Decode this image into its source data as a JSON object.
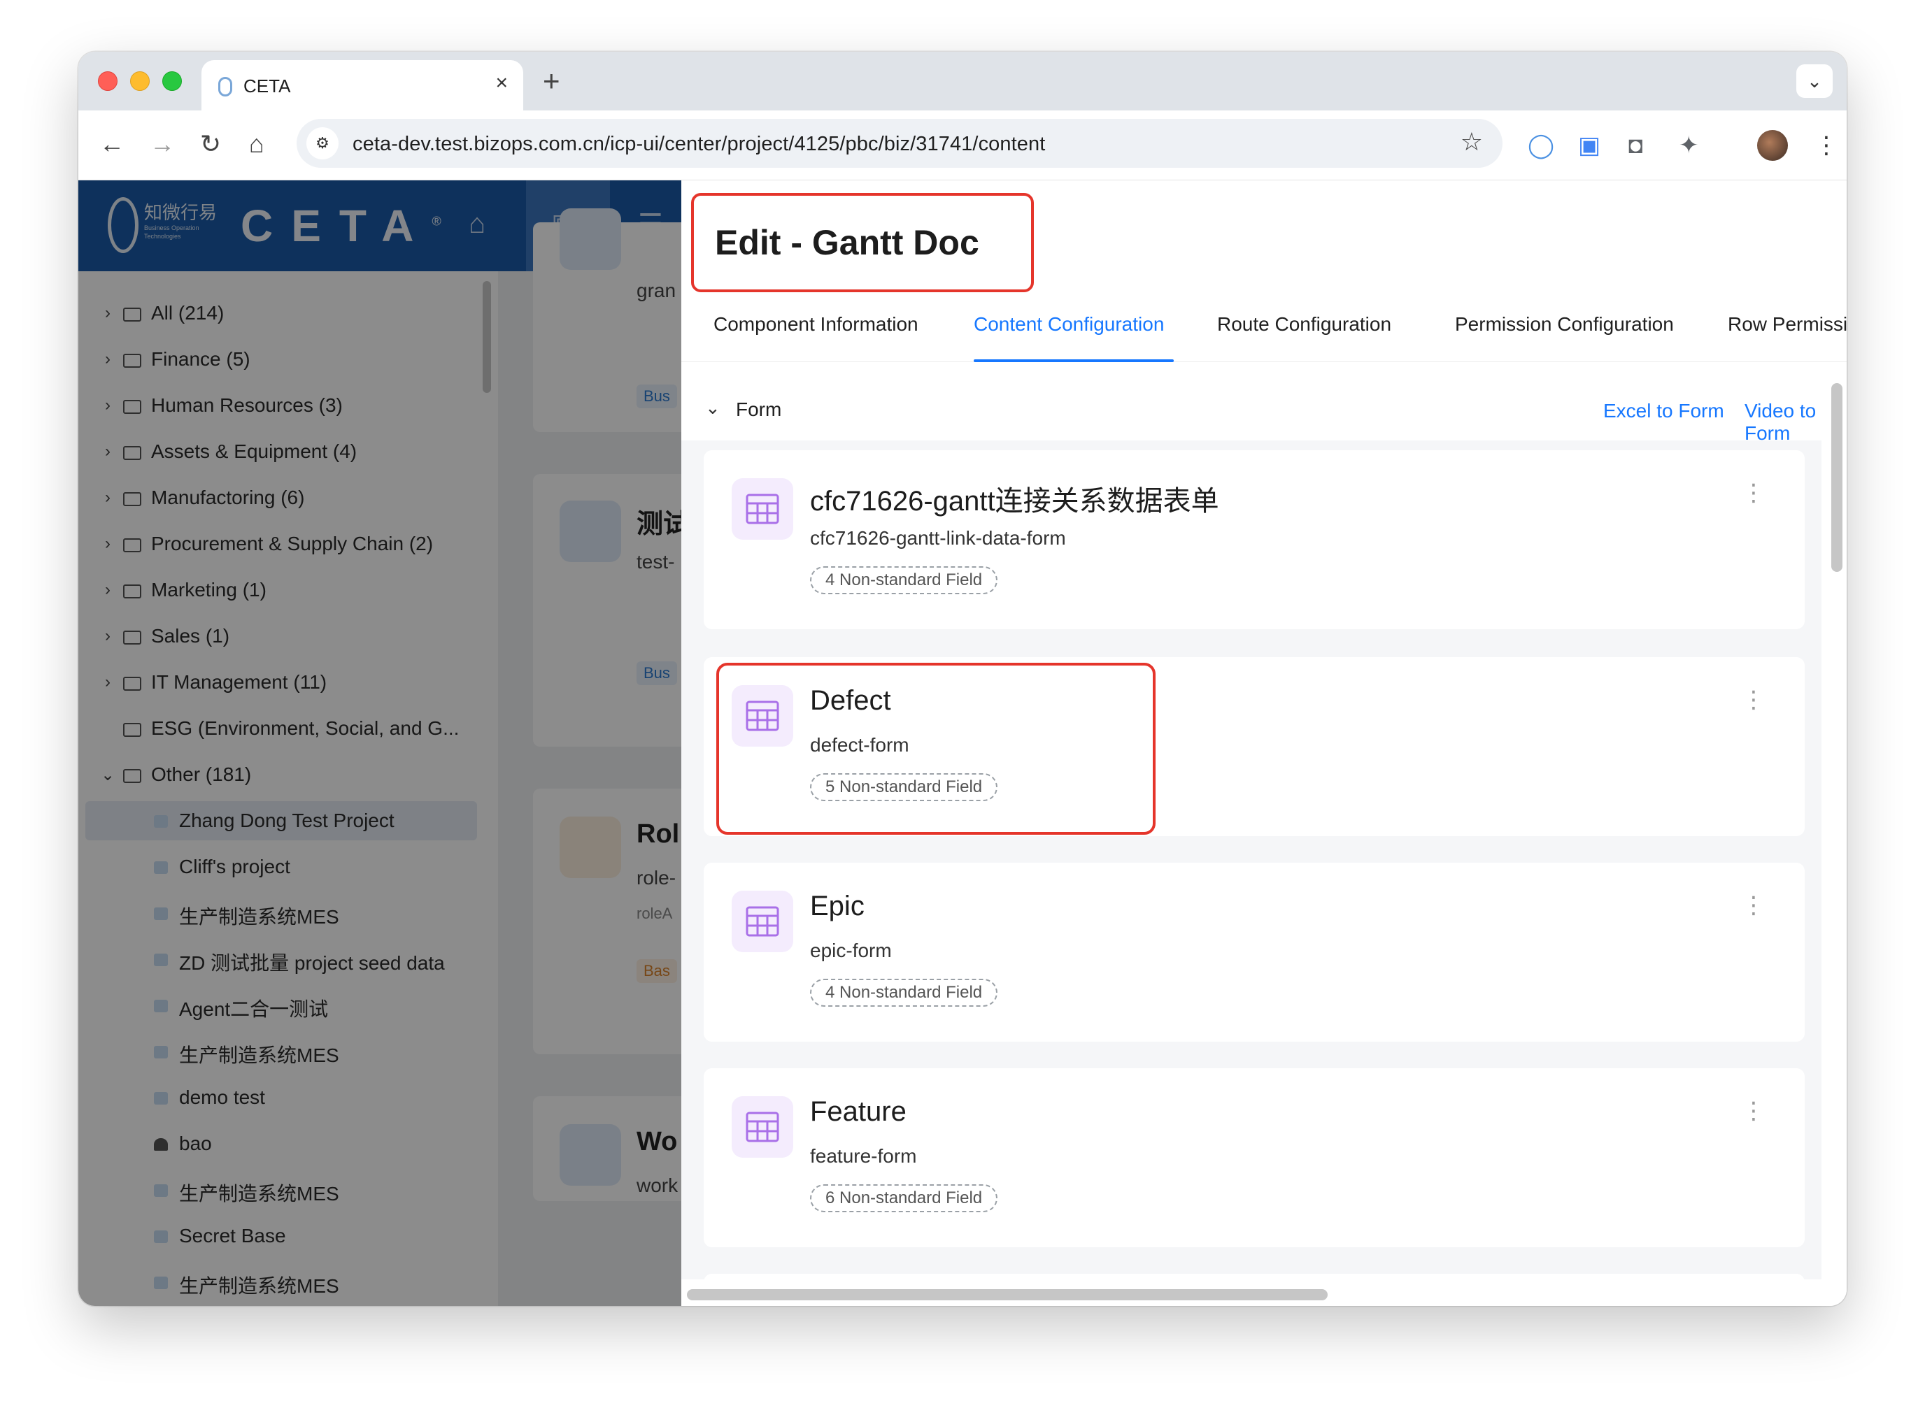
{
  "browser": {
    "tab_title": "CETA",
    "tab_close": "×",
    "new_tab": "+",
    "tab_menu": "⌄",
    "url": "ceta-dev.test.bizops.com.cn/icp-ui/center/project/4125/pbc/biz/31741/content",
    "nav": {
      "back": "←",
      "forward": "→",
      "reload": "↻",
      "home": "⌂"
    },
    "star": "☆",
    "more": "⋮"
  },
  "app": {
    "logo_cn": "知微行易",
    "logo_sub": "Business Operation Technologies",
    "brand": "CETA",
    "brand_mark": "®"
  },
  "sidebar": {
    "categories": [
      {
        "label": "All (214)",
        "chevron": "›"
      },
      {
        "label": "Finance (5)",
        "chevron": "›"
      },
      {
        "label": "Human Resources (3)",
        "chevron": "›"
      },
      {
        "label": "Assets & Equipment (4)",
        "chevron": "›"
      },
      {
        "label": "Manufactoring (6)",
        "chevron": "›"
      },
      {
        "label": "Procurement & Supply Chain (2)",
        "chevron": "›"
      },
      {
        "label": "Marketing (1)",
        "chevron": "›"
      },
      {
        "label": "Sales (1)",
        "chevron": "›"
      },
      {
        "label": "IT Management (11)",
        "chevron": "›"
      },
      {
        "label": "ESG (Environment, Social, and G...",
        "chevron": ""
      },
      {
        "label": "Other (181)",
        "chevron": "⌄"
      }
    ],
    "projects": [
      "Zhang Dong Test Project",
      "Cliff's project",
      "生产制造系统MES",
      "ZD 测试批量 project seed data",
      "Agent二合一测试",
      "生产制造系统MES",
      "demo test",
      "bao",
      "生产制造系统MES",
      "Secret Base",
      "生产制造系统MES"
    ]
  },
  "background_cards": [
    {
      "title": "",
      "sub": "gran",
      "tag": "Bus"
    },
    {
      "title": "测试",
      "sub": "test-",
      "tag": "Bus"
    },
    {
      "title": "Rol",
      "sub": "role-",
      "extra": "roleA",
      "tag": "Bas"
    },
    {
      "title": "Wo",
      "sub": "work",
      "tag": ""
    }
  ],
  "drawer": {
    "title": "Edit - Gantt Doc",
    "tabs": [
      "Component Information",
      "Content Configuration",
      "Route Configuration",
      "Permission Configuration",
      "Row Permissio"
    ],
    "active_tab": "Content Configuration",
    "section": {
      "title": "Form",
      "chevron": "⌄",
      "links": [
        "Excel to Form",
        "Video to Form"
      ]
    },
    "forms": [
      {
        "name": "cfc71626-gantt连接关系数据表单",
        "code": "cfc71626-gantt-link-data-form",
        "badge": "4 Non-standard Field",
        "highlighted": false
      },
      {
        "name": "Defect",
        "code": "defect-form",
        "badge": "5 Non-standard Field",
        "highlighted": true
      },
      {
        "name": "Epic",
        "code": "epic-form",
        "badge": "4 Non-standard Field",
        "highlighted": false
      },
      {
        "name": "Feature",
        "code": "feature-form",
        "badge": "6 Non-standard Field",
        "highlighted": false
      }
    ],
    "more_icon": "⋮"
  },
  "colors": {
    "accent": "#1677ff",
    "highlight": "#e5352b",
    "header_blue": "#1a5aa8",
    "form_icon": "#a970e8"
  }
}
